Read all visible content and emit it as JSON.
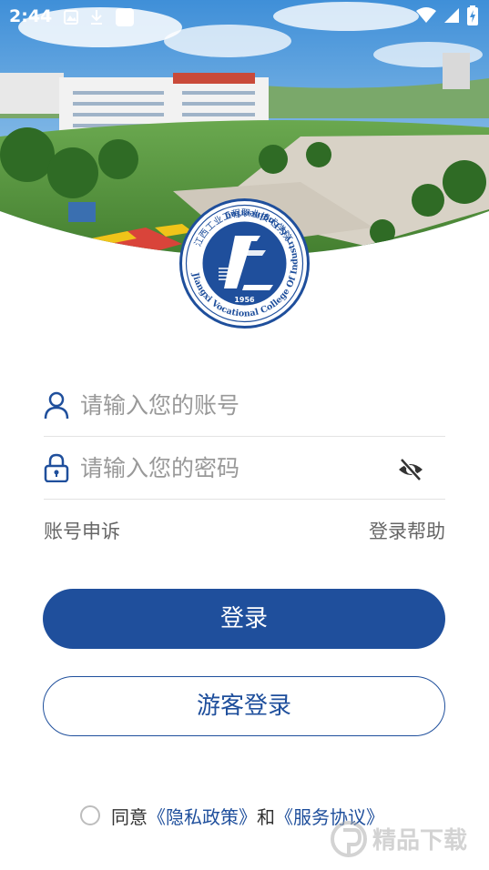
{
  "status_bar": {
    "time": "2:44"
  },
  "logo": {
    "year": "1956",
    "ring_text": "Jiangxi Vocational College Of Industry & Engineering",
    "top_text": "江西工业工程职业技术学院"
  },
  "login_form": {
    "account_placeholder": "请输入您的账号",
    "password_placeholder": "请输入您的密码"
  },
  "links": {
    "appeal": "账号申诉",
    "help": "登录帮助"
  },
  "buttons": {
    "login": "登录",
    "guest_login": "游客登录"
  },
  "agreement": {
    "prefix": "同意",
    "privacy": "《隐私政策》",
    "and": "和",
    "service": "《服务协议》"
  },
  "watermark": {
    "text": "精品下载"
  },
  "colors": {
    "accent": "#1f4f9c",
    "placeholder": "#999999",
    "divider": "#e3e3e3"
  }
}
